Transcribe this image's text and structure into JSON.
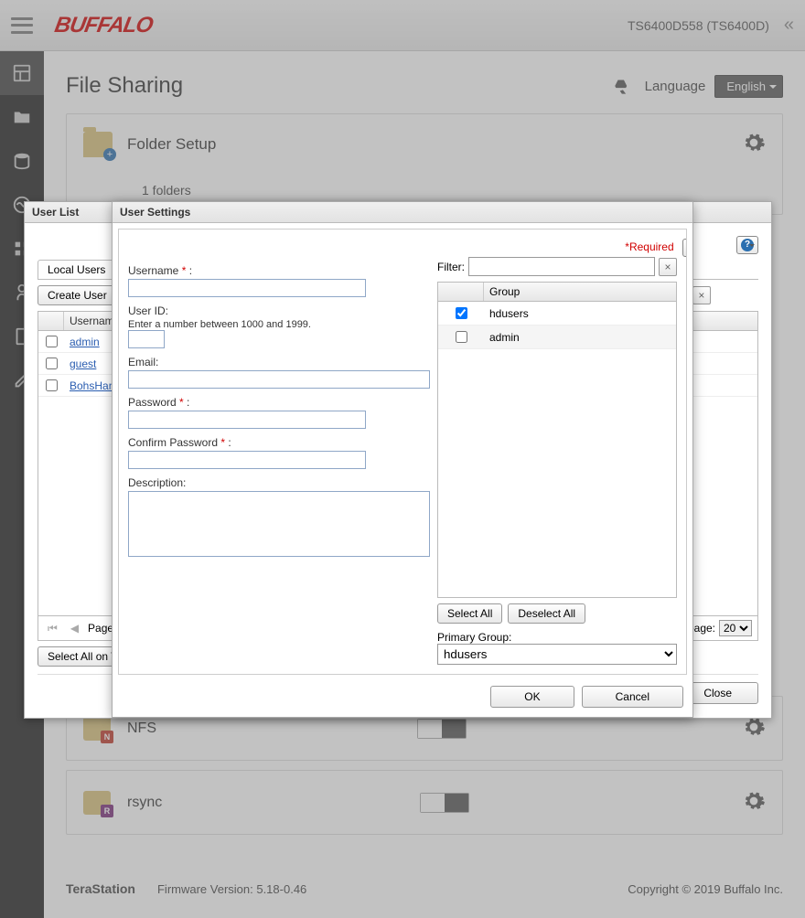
{
  "header": {
    "logo": "BUFFALO",
    "device": "TS6400D558 (TS6400D)"
  },
  "page_title": "File Sharing",
  "language": {
    "label": "Language",
    "selected": "English"
  },
  "folder_setup": {
    "title": "Folder Setup",
    "count_text": "1 folders"
  },
  "user_list": {
    "panel_title": "User List",
    "tabs": {
      "local": "Local Users"
    },
    "create_btn": "Create User",
    "col_username": "Username",
    "rows": [
      {
        "name": "admin",
        "checked": false
      },
      {
        "name": "guest",
        "checked": false
      },
      {
        "name": "BohsHan",
        "checked": false
      }
    ],
    "pager": {
      "page_label": "Page",
      "per_page_label": "page:",
      "per_page_value": "20"
    },
    "select_all_btn": "Select All on This",
    "close_btn": "Close"
  },
  "user_settings": {
    "title": "User Settings",
    "required_label": "*Required",
    "fields": {
      "username_label": "Username",
      "userid_label": "User ID:",
      "userid_hint": "Enter a number between 1000 and 1999.",
      "email_label": "Email:",
      "password_label": "Password",
      "confirm_label": "Confirm Password",
      "description_label": "Description:"
    },
    "filter_label": "Filter:",
    "group_header": "Group",
    "groups": [
      {
        "name": "hdusers",
        "checked": true
      },
      {
        "name": "admin",
        "checked": false
      }
    ],
    "select_all": "Select All",
    "deselect_all": "Deselect All",
    "primary_group_label": "Primary Group:",
    "primary_group_value": "hdusers",
    "ok": "OK",
    "cancel": "Cancel"
  },
  "services": {
    "nfs": "NFS",
    "rsync": "rsync"
  },
  "footer": {
    "brand": "TeraStation",
    "fw": "Firmware Version: 5.18-0.46",
    "copy": "Copyright © 2019 Buffalo Inc."
  }
}
